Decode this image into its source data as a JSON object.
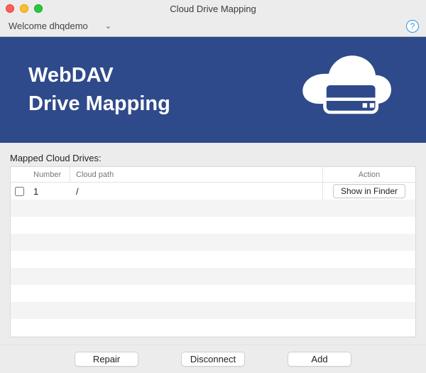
{
  "window": {
    "title": "Cloud Drive Mapping"
  },
  "toolbar": {
    "welcome": "Welcome dhqdemo",
    "help_glyph": "?"
  },
  "banner": {
    "line1": "WebDAV",
    "line2": "Drive Mapping"
  },
  "section": {
    "label": "Mapped Cloud Drives:"
  },
  "table": {
    "headers": {
      "number": "Number",
      "cloud_path": "Cloud path",
      "action": "Action"
    },
    "rows": [
      {
        "number": "1",
        "path": "/",
        "action_label": "Show in Finder"
      }
    ]
  },
  "footer": {
    "repair": "Repair",
    "disconnect": "Disconnect",
    "add": "Add"
  }
}
